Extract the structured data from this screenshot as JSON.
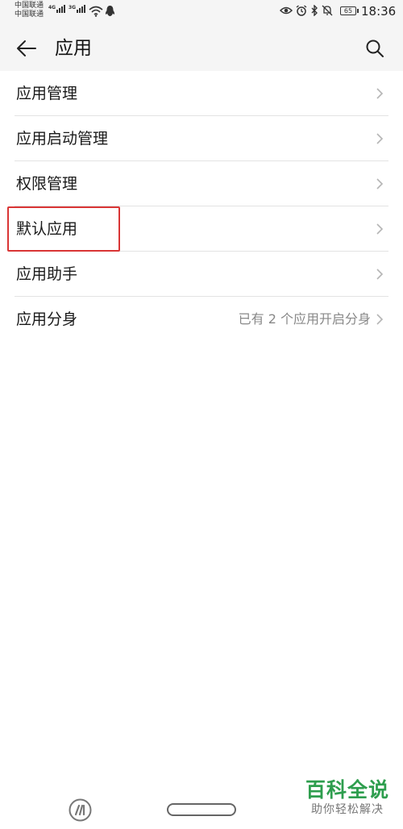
{
  "status_bar": {
    "carrier_1": "中国联通",
    "carrier_2": "中国联通",
    "network_1": "4G",
    "network_2": "3G",
    "battery": "65",
    "time": "18:36"
  },
  "header": {
    "title": "应用",
    "back_icon": "back-arrow-icon",
    "search_icon": "search-icon"
  },
  "list": {
    "items": [
      {
        "label": "应用管理",
        "value": ""
      },
      {
        "label": "应用启动管理",
        "value": ""
      },
      {
        "label": "权限管理",
        "value": ""
      },
      {
        "label": "默认应用",
        "value": ""
      },
      {
        "label": "应用助手",
        "value": ""
      },
      {
        "label": "应用分身",
        "value": "已有 2 个应用开启分身"
      }
    ],
    "highlighted_item": "默认应用",
    "highlight_color": "#d93535"
  },
  "watermark": {
    "title": "百科全说",
    "subtitle": "助你轻松解决"
  },
  "colors": {
    "header_bg": "#f5f5f5",
    "accent_green": "#2e9e4e"
  }
}
